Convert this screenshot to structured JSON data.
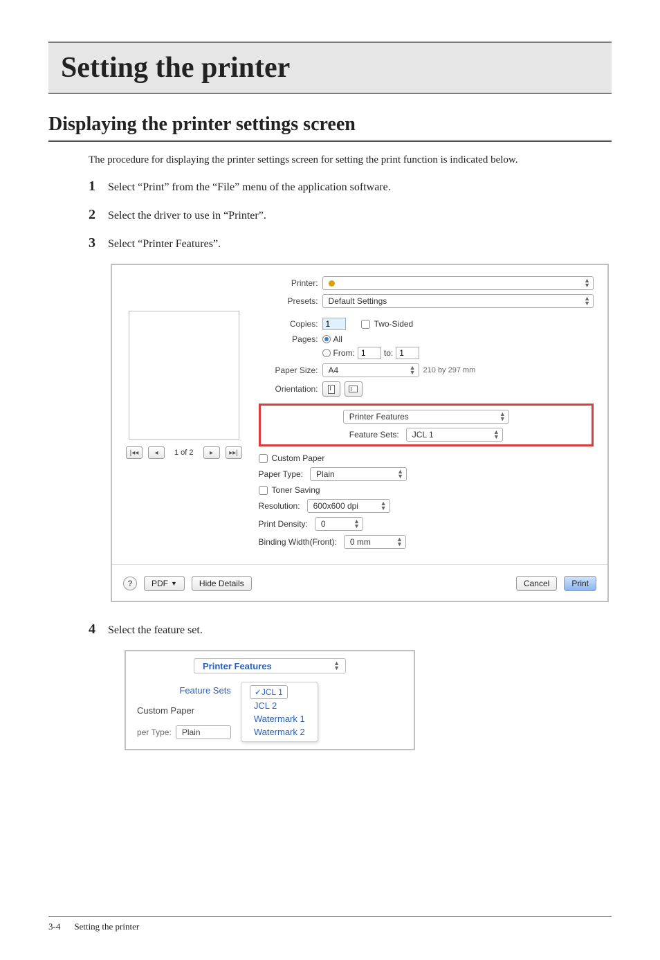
{
  "page": {
    "chapter_title": "Setting the printer",
    "section_title": "Displaying the printer settings screen",
    "description": "The procedure for displaying the printer settings screen for setting the print function is indicated below.",
    "steps": [
      "Select “Print” from the “File” menu of the application software.",
      "Select the driver to use in “Printer”.",
      "Select “Printer Features”.",
      "Select the feature set."
    ],
    "footer_page": "3-4",
    "footer_text": "Setting the printer"
  },
  "dialog": {
    "printer_label": "Printer:",
    "printer_value": "",
    "presets_label": "Presets:",
    "presets_value": "Default Settings",
    "copies_label": "Copies:",
    "copies_value": "1",
    "two_sided": "Two-Sided",
    "pages_label": "Pages:",
    "pages_all": "All",
    "pages_from": "From:",
    "pages_from_value": "1",
    "pages_to": "to:",
    "pages_to_value": "1",
    "paper_size_label": "Paper Size:",
    "paper_size_value": "A4",
    "paper_size_dim": "210 by 297 mm",
    "orientation_label": "Orientation:",
    "pane_value": "Printer Features",
    "feature_sets_label": "Feature Sets:",
    "feature_sets_value": "JCL 1",
    "custom_paper": "Custom Paper",
    "paper_type_label": "Paper Type:",
    "paper_type_value": "Plain",
    "toner_saving": "Toner Saving",
    "resolution_label": "Resolution:",
    "resolution_value": "600x600 dpi",
    "print_density_label": "Print Density:",
    "print_density_value": "0",
    "binding_label": "Binding Width(Front):",
    "binding_value": "0 mm",
    "preview_count": "1 of 2",
    "pdf_label": "PDF",
    "hide_details": "Hide Details",
    "cancel": "Cancel",
    "print": "Print"
  },
  "dropdown": {
    "header": "Printer Features",
    "feature_sets_label": "Feature Sets",
    "custom_paper": "Custom Paper",
    "per_type_label": "per Type:",
    "per_type_value": "Plain",
    "items": [
      "JCL 1",
      "JCL 2",
      "Watermark 1",
      "Watermark 2"
    ]
  }
}
